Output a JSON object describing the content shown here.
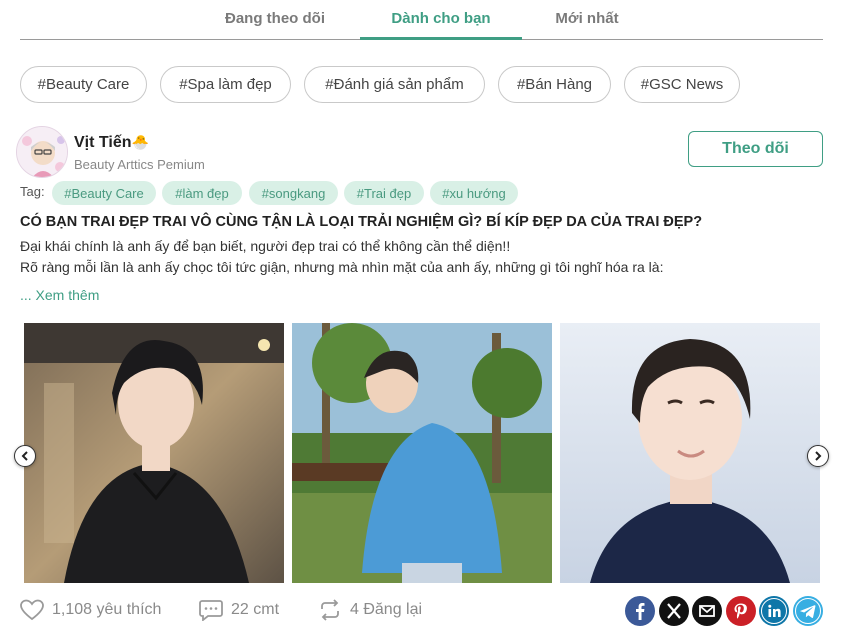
{
  "tabs": [
    {
      "label": "Đang theo dõi"
    },
    {
      "label": "Dành cho bạn"
    },
    {
      "label": "Mới nhất"
    }
  ],
  "topics": [
    {
      "label": "#Beauty Care"
    },
    {
      "label": "#Spa làm đẹp"
    },
    {
      "label": "#Đánh giá sản phẩm"
    },
    {
      "label": "#Bán Hàng"
    },
    {
      "label": "#GSC News"
    }
  ],
  "post": {
    "author": {
      "name": "Vịt Tiến",
      "emoji": "🐣",
      "subtitle": "Beauty Arttics Pemium"
    },
    "follow_label": "Theo dõi",
    "tag_label": "Tag:",
    "tags": [
      "#Beauty Care",
      "#làm đẹp",
      "#songkang",
      "#Trai đẹp",
      "#xu hướng"
    ],
    "title": "CÓ BẠN TRAI ĐẸP TRAI VÔ CÙNG TẬN LÀ LOẠI TRẢI NGHIỆM GÌ? BÍ KÍP ĐẸP DA CỦA TRAI ĐẸP?",
    "lines": [
      "Đại khái chính là anh ấy để bạn biết, người đẹp trai có thể không cần thể diện!!",
      "Rõ ràng mỗi lần là anh ấy chọc tôi tức giận, nhưng mà nhìn mặt của anh ấy, những gì tôi nghĩ hóa ra là:"
    ],
    "see_more": "... Xem thêm",
    "likes": "1,108 yêu thích",
    "comments": "22 cmt",
    "reposts": "4 Đăng lại"
  },
  "icons": {
    "heart": "heart-icon",
    "comment": "comment-icon",
    "repost": "repost-icon",
    "prev": "chevron-left-icon",
    "next": "chevron-right-icon"
  },
  "share": [
    {
      "name": "facebook",
      "color": "#3b5998"
    },
    {
      "name": "x",
      "color": "#111111"
    },
    {
      "name": "email",
      "color": "#111111"
    },
    {
      "name": "pinterest",
      "color": "#cb2027"
    },
    {
      "name": "linkedin",
      "color": "#0e76a8"
    },
    {
      "name": "telegram",
      "color": "#37aee2"
    }
  ],
  "colors": {
    "accent": "#3f9e84",
    "tag_bg": "#d9f0e6"
  }
}
